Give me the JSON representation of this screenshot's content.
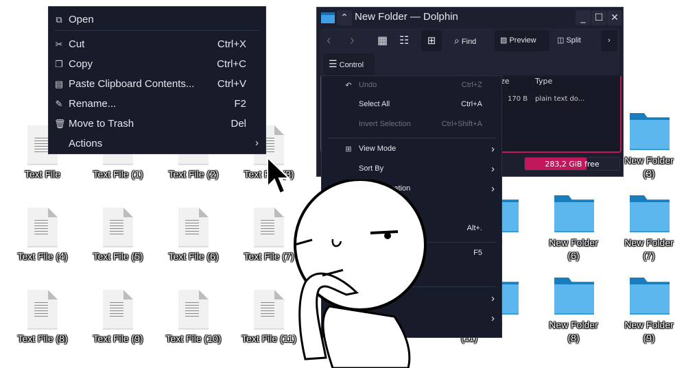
{
  "desktop": {
    "text_files": [
      "Text File",
      "Text File (1)",
      "Text File (2)",
      "Text File (3)",
      "Text File (4)",
      "Text File (5)",
      "Text File (6)",
      "Text File (7)",
      "Text File (8)",
      "Text File (9)",
      "Text File (10)",
      "Text File (11)"
    ],
    "folders": [
      {
        "name": "New Folder",
        "num": "(3)"
      },
      {
        "name": "New Folder",
        "num": "(6)"
      },
      {
        "name": "New Folder",
        "num": "(7)"
      },
      {
        "name": "New Folder",
        "num": "(8)"
      },
      {
        "name": "New Folder",
        "num": "(9)"
      }
    ],
    "partial_labels": [
      "(10)",
      "(11)",
      "older",
      "older"
    ]
  },
  "file_menu": {
    "items": [
      {
        "icon": "open-icon",
        "glyph": "⧉",
        "label": "Open",
        "shortcut": ""
      },
      {
        "icon": "cut-icon",
        "glyph": "✂",
        "label": "Cut",
        "shortcut": "Ctrl+X"
      },
      {
        "icon": "copy-icon",
        "glyph": "❐",
        "label": "Copy",
        "shortcut": "Ctrl+C"
      },
      {
        "icon": "paste-icon",
        "glyph": "▤",
        "label": "Paste Clipboard Contents...",
        "shortcut": "Ctrl+V"
      },
      {
        "icon": "rename-icon",
        "glyph": "✎",
        "label": "Rename...",
        "shortcut": "F2"
      },
      {
        "icon": "trash-icon",
        "glyph": "🗑",
        "label": "Move to Trash",
        "shortcut": "Del"
      },
      {
        "icon": "",
        "glyph": "",
        "label": "Actions",
        "shortcut": "",
        "submenu": true
      }
    ]
  },
  "dolphin": {
    "title": "New Folder — Dolphin",
    "toolbar": {
      "find": "Find",
      "preview": "Preview",
      "split": "Split",
      "control": "Control"
    },
    "columns": {
      "size": "ze",
      "type": "Type"
    },
    "row": {
      "size": "170 B",
      "type": "plain text do..."
    },
    "free_space": "283,2 GiB free",
    "disk_used_fraction": 0.65,
    "accent": "#c2185b"
  },
  "control_menu": {
    "items": [
      {
        "label": "Undo",
        "shortcut": "Ctrl+Z",
        "disabled": true,
        "glyph": "↶"
      },
      {
        "label": "Select All",
        "shortcut": "Ctrl+A"
      },
      {
        "label": "Invert Selection",
        "shortcut": "Ctrl+Shift+A",
        "disabled": true
      },
      {
        "label": "View Mode",
        "submenu": true,
        "glyph": "⊞"
      },
      {
        "label": "Sort By",
        "submenu": true
      },
      {
        "label": "…d Information",
        "submenu": true
      },
      {
        "label": "…s"
      },
      {
        "label": "",
        "shortcut": "Alt+."
      },
      {
        "label": "",
        "shortcut": "F5"
      },
      {
        "label": "…perties..."
      },
      {
        "label": "",
        "submenu": true
      },
      {
        "label": "",
        "submenu": true
      }
    ]
  }
}
